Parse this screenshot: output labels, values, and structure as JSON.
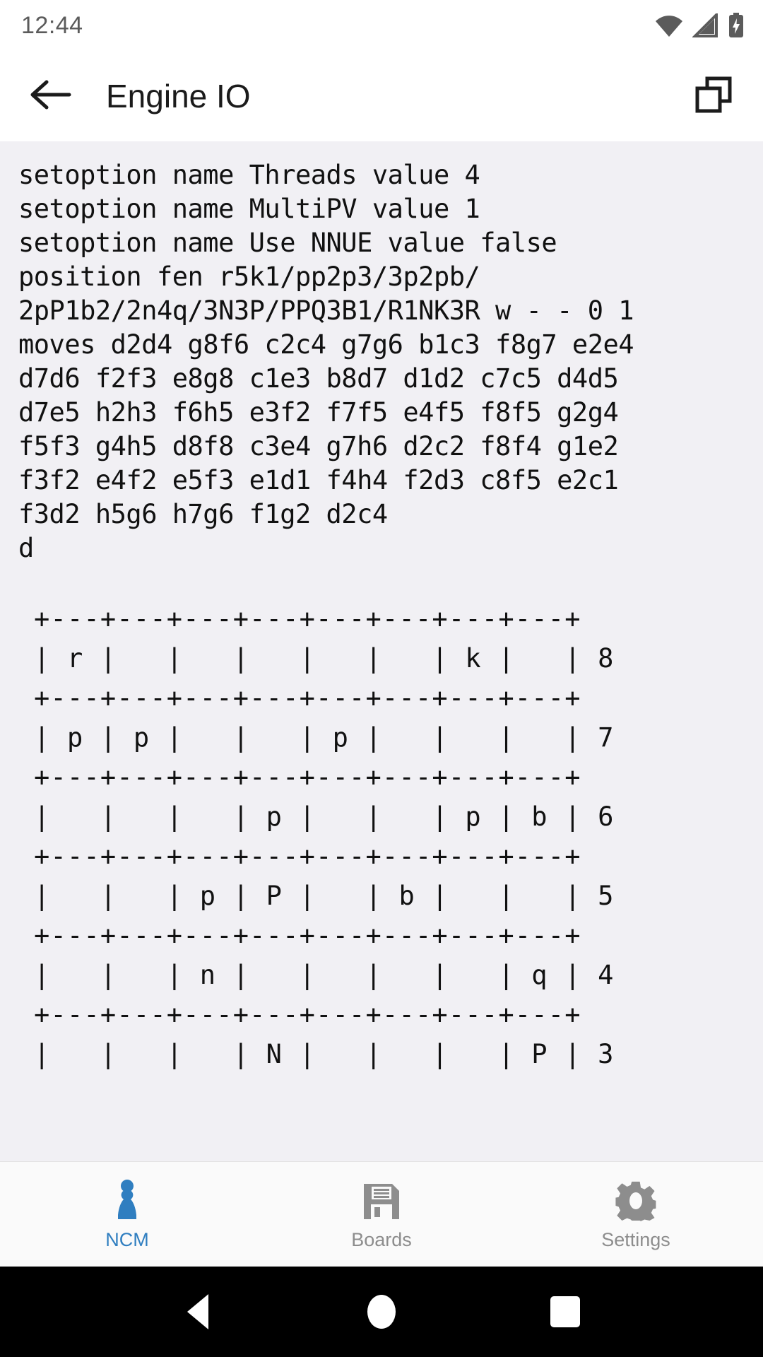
{
  "status_bar": {
    "clock": "12:44",
    "icons": [
      "wifi-icon",
      "cell-signal-icon",
      "battery-charging-icon"
    ]
  },
  "app_bar": {
    "back_icon": "arrow-back-icon",
    "title": "Engine IO",
    "action_icon": "copy-icon"
  },
  "console": {
    "log": "setoption name Threads value 4\nsetoption name MultiPV value 1\nsetoption name Use NNUE value false\nposition fen r5k1/pp2p3/3p2pb/\n2pP1b2/2n4q/3N3P/PPQ3B1/R1NK3R w - - 0 1\nmoves d2d4 g8f6 c2c4 g7g6 b1c3 f8g7 e2e4\nd7d6 f2f3 e8g8 c1e3 b8d7 d1d2 c7c5 d4d5\nd7e5 h2h3 f6h5 e3f2 f7f5 e4f5 f8f5 g2g4\nf5f3 g4h5 d8f8 c3e4 g7h6 d2c2 f8f4 g1e2\nf3f2 e4f2 e5f3 e1d1 f4h4 f2d3 c8f5 e2c1\nf3d2 h5g6 h7g6 f1g2 d2c4\nd",
    "board": "+---+---+---+---+---+---+---+---+\n| r |   |   |   |   |   | k |   | 8\n+---+---+---+---+---+---+---+---+\n| p | p |   |   | p |   |   |   | 7\n+---+---+---+---+---+---+---+---+\n|   |   |   | p |   |   | p | b | 6\n+---+---+---+---+---+---+---+---+\n|   |   | p | P |   | b |   |   | 5\n+---+---+---+---+---+---+---+---+\n|   |   | n |   |   |   |   | q | 4\n+---+---+---+---+---+---+---+---+\n|   |   |   | N |   |   |   | P | 3"
  },
  "tab_bar": {
    "tabs": [
      {
        "label": "NCM",
        "icon": "chess-pawn-icon",
        "active": true
      },
      {
        "label": "Boards",
        "icon": "save-floppy-icon",
        "active": false
      },
      {
        "label": "Settings",
        "icon": "gear-icon",
        "active": false
      }
    ]
  },
  "nav_bar": {
    "back": "nav-back-icon",
    "home": "nav-home-icon",
    "recents": "nav-recents-icon"
  },
  "colors": {
    "accent": "#2f7ec0",
    "console_bg": "#f1f0f4",
    "inactive": "#8d8d8d",
    "text": "#111111"
  }
}
